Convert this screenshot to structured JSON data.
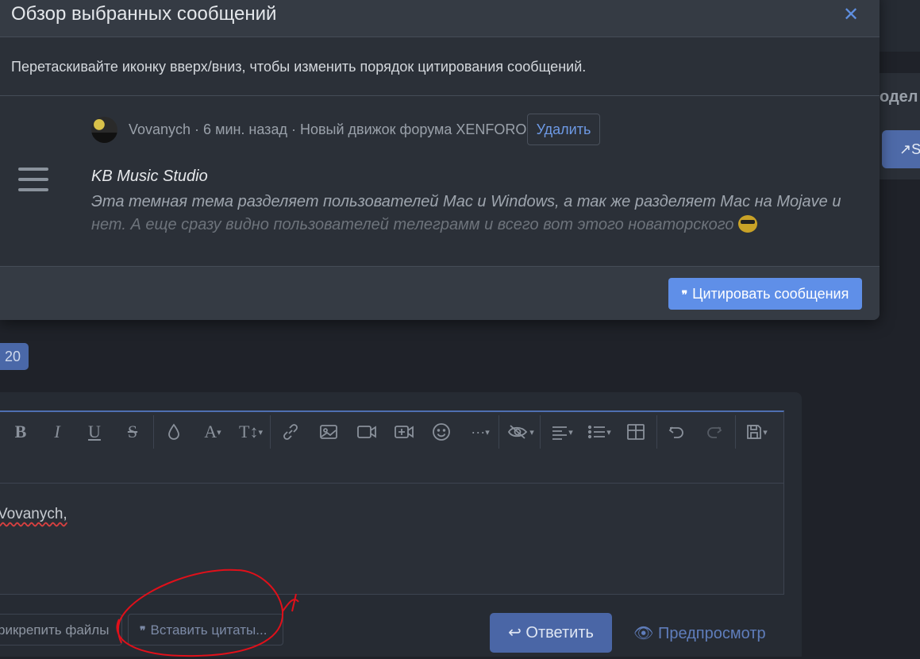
{
  "modal": {
    "title": "Обзор выбранных сообщений",
    "close": "✕",
    "hint": "Перетаскивайте иконку вверх/вниз, чтобы изменить порядок цитирования сообщений.",
    "post": {
      "meta": "Vovanych · 6 мин. назад · Новый движок форума XENFORO",
      "delete_label": "Удалить",
      "title": "KB Music Studio",
      "body_line1": "Эта темная тема разделяет пользователей Mac и Windows, а так же разделяет Mac на Mojave и",
      "body_line2": "нет. А еще сразу видно пользователей телеграмм и всего вот этого новаторского"
    },
    "quote_button": "Цитировать сообщения",
    "quote_glyph": "❞"
  },
  "background": {
    "model_text": "одел",
    "share_text": "S",
    "page_badge": "20"
  },
  "editor": {
    "text": "Vovanych,",
    "toolbar": [
      "bold",
      "italic",
      "underline",
      "strikethrough",
      "text-color",
      "font-family",
      "font-size",
      "link",
      "image",
      "media",
      "insert-video",
      "emoji",
      "more",
      "spoiler",
      "align",
      "list",
      "table",
      "undo",
      "redo",
      "drafts"
    ],
    "attach_label": "рикрепить файлы",
    "insert_quotes_label": "Вставить цитаты...",
    "reply_label": "Ответить",
    "preview_label": "Предпросмотр"
  },
  "colors": {
    "accent": "#5f8fe8",
    "annotation": "#e0101a"
  }
}
